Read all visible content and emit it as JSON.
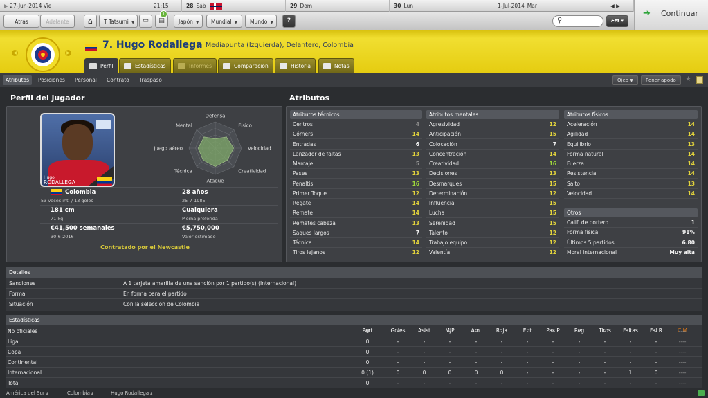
{
  "calendar": [
    {
      "date": "27-Jun-2014",
      "day": "Vie",
      "time": "21:15"
    },
    {
      "num": "28",
      "day": "Sáb"
    },
    {
      "num": "29",
      "day": "Dom"
    },
    {
      "num": "30",
      "day": "Lun"
    },
    {
      "num": "1-Jul-2014",
      "day": "Mar"
    }
  ],
  "toolbar": {
    "back": "Atrás",
    "forward": "Adelante",
    "manager": "T Tatsumi",
    "notif_count": "1",
    "japan": "Japón",
    "world_cup": "Mundial",
    "world": "Mundo",
    "help": "?",
    "fm": "FM",
    "continue": "Continuar",
    "arrows": "◀ ▶"
  },
  "player": {
    "title": "7. Hugo Rodallega",
    "positions": "Mediapunta (Izquierda), Delantero, Colombia",
    "photo_first": "Hugo",
    "photo_last": "RODALLEGA"
  },
  "tabs": [
    {
      "label": "Perfil",
      "state": "active"
    },
    {
      "label": "Estadísticas",
      "state": "normal"
    },
    {
      "label": "Informes",
      "state": "disabled"
    },
    {
      "label": "Comparación",
      "state": "normal"
    },
    {
      "label": "Historia",
      "state": "normal"
    },
    {
      "label": "Notas",
      "state": "normal"
    }
  ],
  "subnav": {
    "items": [
      "Atributos",
      "Posiciones",
      "Personal",
      "Contrato",
      "Traspaso"
    ],
    "scout": "Ojeo",
    "offer": "Poner apodo"
  },
  "profile": {
    "title": "Perfil del jugador",
    "radar_labels": [
      "Defensa",
      "Físico",
      "Velocidad",
      "Creatividad",
      "Ataque",
      "Técnica",
      "Juego aéreo",
      "Mental"
    ],
    "radar_values": [
      0.35,
      0.6,
      0.7,
      0.65,
      0.7,
      0.65,
      0.65,
      0.6
    ],
    "nation": "Colombia",
    "caps": "53 veces int. / 13 goles",
    "age": "28 años",
    "dob": "25-7-1985",
    "height": "181 cm",
    "weight": "71 kg",
    "foot": "Cualquiera",
    "foot_label": "Pierna preferida",
    "wage": "€41,500 semanales",
    "contract_end": "30-6-2016",
    "value": "€5,750,000",
    "value_label": "Valor estimado",
    "status": "Contratado por el Newcastle"
  },
  "attributes": {
    "title": "Atributos",
    "technical_title": "Atributos técnicos",
    "mental_title": "Atributos mentales",
    "physical_title": "Atributos físicos",
    "other_title": "Otros",
    "technical": [
      {
        "name": "Centros",
        "value": "4"
      },
      {
        "name": "Córners",
        "value": "14"
      },
      {
        "name": "Entradas",
        "value": "6"
      },
      {
        "name": "Lanzador de faltas",
        "value": "13"
      },
      {
        "name": "Marcaje",
        "value": "5"
      },
      {
        "name": "Pases",
        "value": "13"
      },
      {
        "name": "Penaltis",
        "value": "16"
      },
      {
        "name": "Primer Toque",
        "value": "12"
      },
      {
        "name": "Regate",
        "value": "14"
      },
      {
        "name": "Remate",
        "value": "14"
      },
      {
        "name": "Remates cabeza",
        "value": "13"
      },
      {
        "name": "Saques largos",
        "value": "7"
      },
      {
        "name": "Técnica",
        "value": "14"
      },
      {
        "name": "Tiros lejanos",
        "value": "12"
      }
    ],
    "mental": [
      {
        "name": "Agresividad",
        "value": "12"
      },
      {
        "name": "Anticipación",
        "value": "15"
      },
      {
        "name": "Colocación",
        "value": "7"
      },
      {
        "name": "Concentración",
        "value": "14"
      },
      {
        "name": "Creatividad",
        "value": "16"
      },
      {
        "name": "Decisiones",
        "value": "13"
      },
      {
        "name": "Desmarques",
        "value": "15"
      },
      {
        "name": "Determinación",
        "value": "12"
      },
      {
        "name": "Influencia",
        "value": "15"
      },
      {
        "name": "Lucha",
        "value": "15"
      },
      {
        "name": "Serenidad",
        "value": "15"
      },
      {
        "name": "Talento",
        "value": "12"
      },
      {
        "name": "Trabajo equipo",
        "value": "12"
      },
      {
        "name": "Valentía",
        "value": "12"
      }
    ],
    "physical": [
      {
        "name": "Aceleración",
        "value": "14"
      },
      {
        "name": "Agilidad",
        "value": "14"
      },
      {
        "name": "Equilibrio",
        "value": "13"
      },
      {
        "name": "Forma natural",
        "value": "14"
      },
      {
        "name": "Fuerza",
        "value": "14"
      },
      {
        "name": "Resistencia",
        "value": "14"
      },
      {
        "name": "Salto",
        "value": "13"
      },
      {
        "name": "Velocidad",
        "value": "14"
      }
    ],
    "other": [
      {
        "name": "Calif. de portero",
        "value": "1"
      },
      {
        "name": "Forma física",
        "value": "91%"
      },
      {
        "name": "Últimos 5 partidos",
        "value": "6.80"
      },
      {
        "name": "Moral internacional",
        "value": "Muy alta"
      }
    ]
  },
  "details": {
    "title": "Detalles",
    "rows": [
      {
        "key": "Sanciones",
        "value": "A 1 tarjeta amarilla de una sanción por 1 partido(s) (Internacional)"
      },
      {
        "key": "Forma",
        "value": "En forma para el partido"
      },
      {
        "key": "Situación",
        "value": "Con la selección de Colombia"
      }
    ]
  },
  "stats": {
    "title": "Estadísticas",
    "columns": [
      "Part",
      "Goles",
      "Asist",
      "MJP",
      "Am.",
      "Roja",
      "Ent",
      "Pas P",
      "Reg",
      "Tiros",
      "Faltas",
      "Fal R",
      "C M"
    ],
    "rows": [
      {
        "label": "No oficiales",
        "cells": [
          "0",
          "-",
          "-",
          "-",
          "-",
          "-",
          "-",
          "-",
          "-",
          "-",
          "-",
          "-",
          "----"
        ]
      },
      {
        "label": "Liga",
        "cells": [
          "0",
          "-",
          "-",
          "-",
          "-",
          "-",
          "-",
          "-",
          "-",
          "-",
          "-",
          "-",
          "----"
        ]
      },
      {
        "label": "Copa",
        "cells": [
          "0",
          "-",
          "-",
          "-",
          "-",
          "-",
          "-",
          "-",
          "-",
          "-",
          "-",
          "-",
          "----"
        ]
      },
      {
        "label": "Continental",
        "cells": [
          "0",
          "-",
          "-",
          "-",
          "-",
          "-",
          "-",
          "-",
          "-",
          "-",
          "-",
          "-",
          "----"
        ]
      },
      {
        "label": "Internacional",
        "cells": [
          "0 (1)",
          "0",
          "0",
          "0",
          "0",
          "0",
          "-",
          "-",
          "-",
          "-",
          "1",
          "0",
          "----"
        ]
      },
      {
        "label": "Total",
        "cells": [
          "0",
          "-",
          "-",
          "-",
          "-",
          "-",
          "-",
          "-",
          "-",
          "-",
          "-",
          "-",
          "----"
        ]
      }
    ]
  },
  "breadcrumb": [
    "América del Sur",
    "Colombia",
    "Hugo Rodallega"
  ]
}
